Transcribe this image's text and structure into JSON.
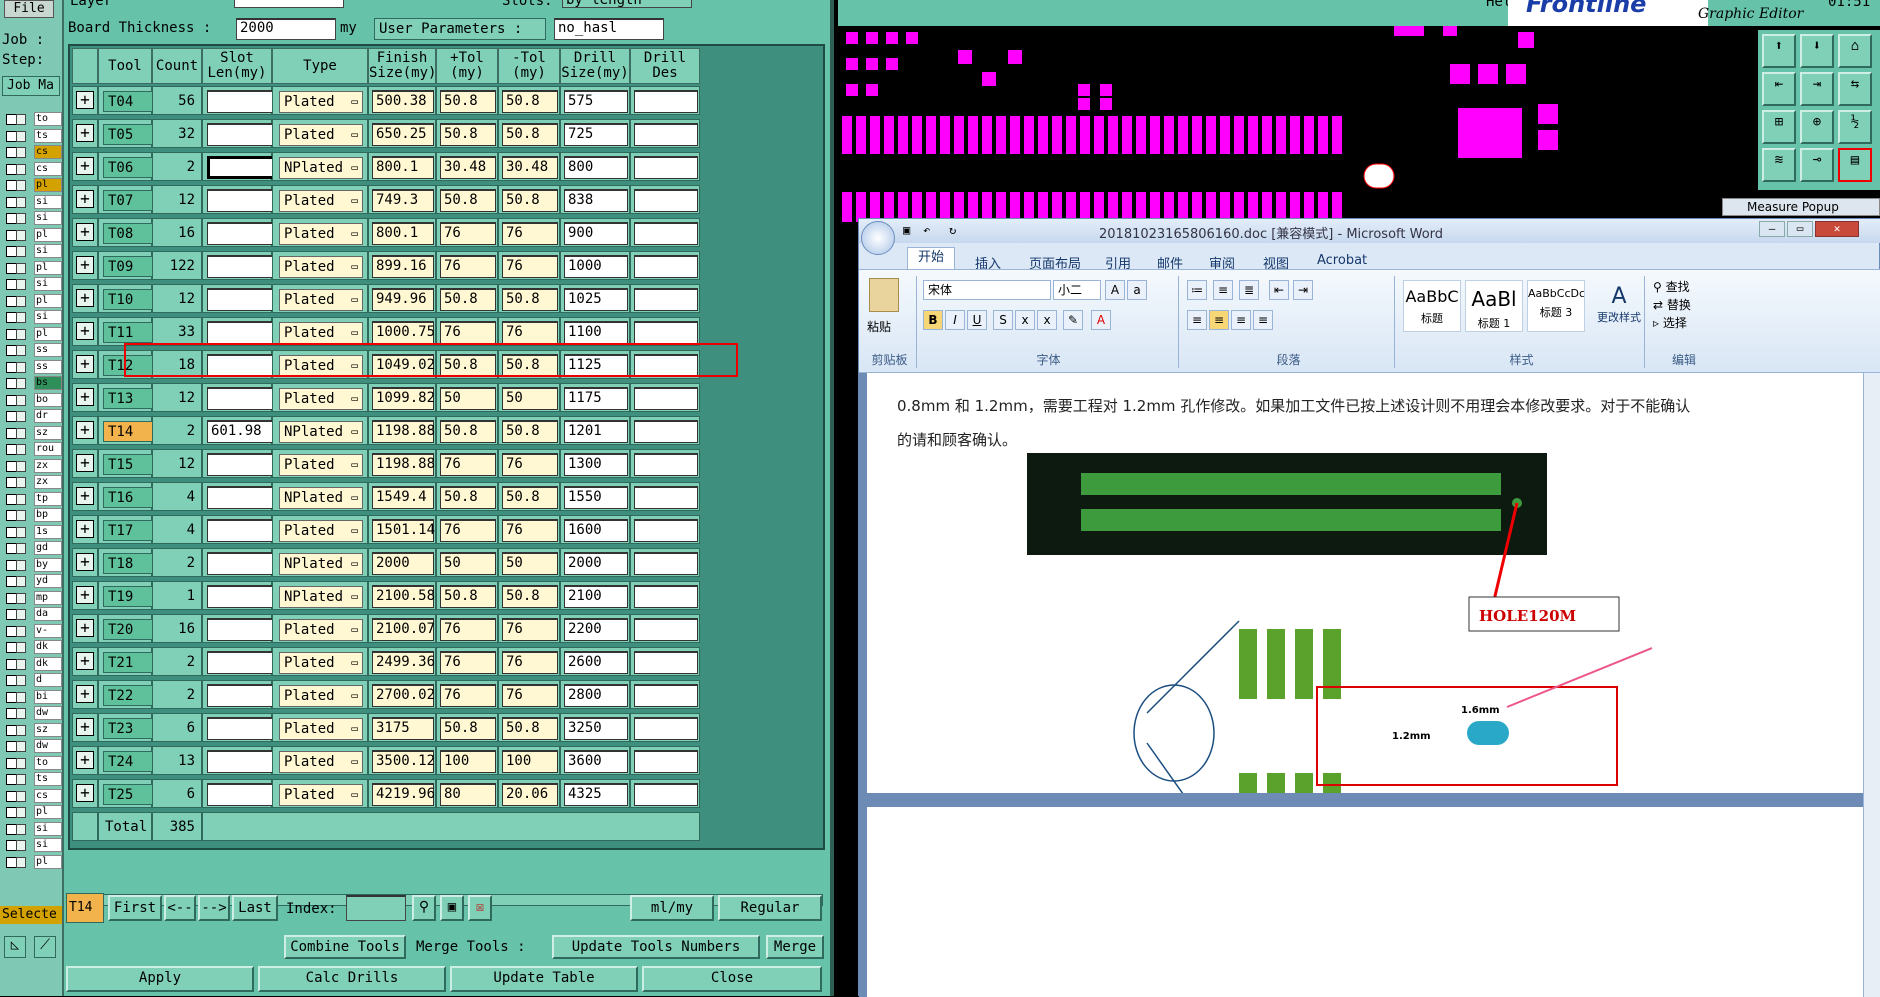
{
  "left_strip": {
    "file_button": "File",
    "job_label": "Job :",
    "step_label": "Step:",
    "job_matrix_button": "Job Ma",
    "layers": [
      "to",
      "ts",
      "cs",
      "cs",
      "pl",
      "si",
      "si",
      "pl",
      "si",
      "pl",
      "si",
      "pl",
      "si",
      "pl",
      "ss",
      "ss",
      "bs",
      "bo",
      "dr",
      "sz",
      "rou",
      "zx",
      "zx",
      "tp",
      "bp",
      "1s",
      "gd",
      "by",
      "yd",
      "mp",
      "da",
      "v-",
      "dk",
      "dk",
      "d",
      "bi",
      "dw",
      "sz",
      "dw",
      "to",
      "ts",
      "cs",
      "pl",
      "si",
      "si",
      "pl"
    ],
    "selected_label": "Selecte"
  },
  "tool_manager": {
    "layer_label": "Layer",
    "slots_label": "Slots:",
    "slots_value": "by length",
    "board_thickness_label": "Board Thickness :",
    "board_thickness_value": "2000",
    "board_thickness_unit": "my",
    "user_params_label": "User Parameters :",
    "user_params_value": "no_hasl",
    "headers": {
      "tool": "Tool",
      "count": "Count",
      "slot": "Slot Len(my)",
      "type": "Type",
      "finish": "Finish Size(my)",
      "ptol": "+Tol (my)",
      "ntol": "-Tol (my)",
      "drill": "Drill Size(my)",
      "des": "Drill Des"
    },
    "rows": [
      {
        "tool": "T04",
        "count": "56",
        "slot": "",
        "type": "Plated",
        "finish": "500.38",
        "ptol": "50.8",
        "ntol": "50.8",
        "drill": "575"
      },
      {
        "tool": "T05",
        "count": "32",
        "slot": "",
        "type": "Plated",
        "finish": "650.25",
        "ptol": "50.8",
        "ntol": "50.8",
        "drill": "725"
      },
      {
        "tool": "T06",
        "count": "2",
        "slot": "",
        "type": "NPlated",
        "finish": "800.1",
        "ptol": "30.48",
        "ntol": "30.48",
        "drill": "800"
      },
      {
        "tool": "T07",
        "count": "12",
        "slot": "",
        "type": "Plated",
        "finish": "749.3",
        "ptol": "50.8",
        "ntol": "50.8",
        "drill": "838"
      },
      {
        "tool": "T08",
        "count": "16",
        "slot": "",
        "type": "Plated",
        "finish": "800.1",
        "ptol": "76",
        "ntol": "76",
        "drill": "900"
      },
      {
        "tool": "T09",
        "count": "122",
        "slot": "",
        "type": "Plated",
        "finish": "899.16",
        "ptol": "76",
        "ntol": "76",
        "drill": "1000"
      },
      {
        "tool": "T10",
        "count": "12",
        "slot": "",
        "type": "Plated",
        "finish": "949.96",
        "ptol": "50.8",
        "ntol": "50.8",
        "drill": "1025"
      },
      {
        "tool": "T11",
        "count": "33",
        "slot": "",
        "type": "Plated",
        "finish": "1000.75",
        "ptol": "76",
        "ntol": "76",
        "drill": "1100"
      },
      {
        "tool": "T12",
        "count": "18",
        "slot": "",
        "type": "Plated",
        "finish": "1049.02",
        "ptol": "50.8",
        "ntol": "50.8",
        "drill": "1125"
      },
      {
        "tool": "T13",
        "count": "12",
        "slot": "",
        "type": "Plated",
        "finish": "1099.82",
        "ptol": "50",
        "ntol": "50",
        "drill": "1175"
      },
      {
        "tool": "T14",
        "count": "2",
        "slot": "601.98",
        "type": "NPlated",
        "finish": "1198.88",
        "ptol": "50.8",
        "ntol": "50.8",
        "drill": "1201"
      },
      {
        "tool": "T15",
        "count": "12",
        "slot": "",
        "type": "Plated",
        "finish": "1198.88",
        "ptol": "76",
        "ntol": "76",
        "drill": "1300"
      },
      {
        "tool": "T16",
        "count": "4",
        "slot": "",
        "type": "NPlated",
        "finish": "1549.4",
        "ptol": "50.8",
        "ntol": "50.8",
        "drill": "1550"
      },
      {
        "tool": "T17",
        "count": "4",
        "slot": "",
        "type": "Plated",
        "finish": "1501.14",
        "ptol": "76",
        "ntol": "76",
        "drill": "1600"
      },
      {
        "tool": "T18",
        "count": "2",
        "slot": "",
        "type": "NPlated",
        "finish": "2000",
        "ptol": "50",
        "ntol": "50",
        "drill": "2000"
      },
      {
        "tool": "T19",
        "count": "1",
        "slot": "",
        "type": "NPlated",
        "finish": "2100.58",
        "ptol": "50.8",
        "ntol": "50.8",
        "drill": "2100"
      },
      {
        "tool": "T20",
        "count": "16",
        "slot": "",
        "type": "Plated",
        "finish": "2100.07",
        "ptol": "76",
        "ntol": "76",
        "drill": "2200"
      },
      {
        "tool": "T21",
        "count": "2",
        "slot": "",
        "type": "Plated",
        "finish": "2499.36",
        "ptol": "76",
        "ntol": "76",
        "drill": "2600"
      },
      {
        "tool": "T22",
        "count": "2",
        "slot": "",
        "type": "Plated",
        "finish": "2700.02",
        "ptol": "76",
        "ntol": "76",
        "drill": "2800"
      },
      {
        "tool": "T23",
        "count": "6",
        "slot": "",
        "type": "Plated",
        "finish": "3175",
        "ptol": "50.8",
        "ntol": "50.8",
        "drill": "3250"
      },
      {
        "tool": "T24",
        "count": "13",
        "slot": "",
        "type": "Plated",
        "finish": "3500.12",
        "ptol": "100",
        "ntol": "100",
        "drill": "3600"
      },
      {
        "tool": "T25",
        "count": "6",
        "slot": "",
        "type": "Plated",
        "finish": "4219.96",
        "ptol": "80",
        "ntol": "20.06",
        "drill": "4325"
      }
    ],
    "total_label": "Total",
    "total_value": "385",
    "current_tool": "T14",
    "nav": {
      "first": "First",
      "prev": "<--",
      "next": "-->",
      "last": "Last",
      "index_label": "Index:"
    },
    "unit_select": "ml/my",
    "mode_select": "Regular",
    "combine_tools": "Combine Tools",
    "merge_tools_label": "Merge Tools :",
    "update_numbers": "Update Tools Numbers",
    "merge": "Merge",
    "apply": "Apply",
    "calc_drills": "Calc Drills",
    "update_table": "Update Table",
    "close": "Close"
  },
  "graphic_editor": {
    "help": "Help",
    "brand": "Frontline",
    "subtitle": "Graphic Editor",
    "clock": "01:51",
    "measure_popup": "Measure Popup"
  },
  "word": {
    "title": "20181023165806160.doc [兼容模式] - Microsoft Word",
    "tabs": [
      "开始",
      "插入",
      "页面布局",
      "引用",
      "邮件",
      "审阅",
      "视图",
      "Acrobat"
    ],
    "font_name": "宋体",
    "font_size": "小二",
    "paste_label": "粘贴",
    "clipboard_group": "剪贴板",
    "font_group": "字体",
    "paragraph_group": "段落",
    "styles_group": "样式",
    "edit_group": "编辑",
    "styles": [
      {
        "sample": "AaBbC",
        "name": "标题"
      },
      {
        "sample": "AaBl",
        "name": "标题 1"
      },
      {
        "sample": "AaBbCcDc",
        "name": "标题 3"
      }
    ],
    "change_styles": "更改样式",
    "find": "查找",
    "replace": "替换",
    "select": "选择",
    "body_line1": "0.8mm 和 1.2mm，需要工程对 1.2mm 孔作修改。如果加工文件已按上述设计则不用理会本修改要求。对于不能确认",
    "body_line2": "的请和顾客确认。",
    "callout": "HOLE120M",
    "dim_1_6": "1.6mm",
    "dim_1_2": "1.2mm",
    "accent_color": "#ff00ff"
  }
}
